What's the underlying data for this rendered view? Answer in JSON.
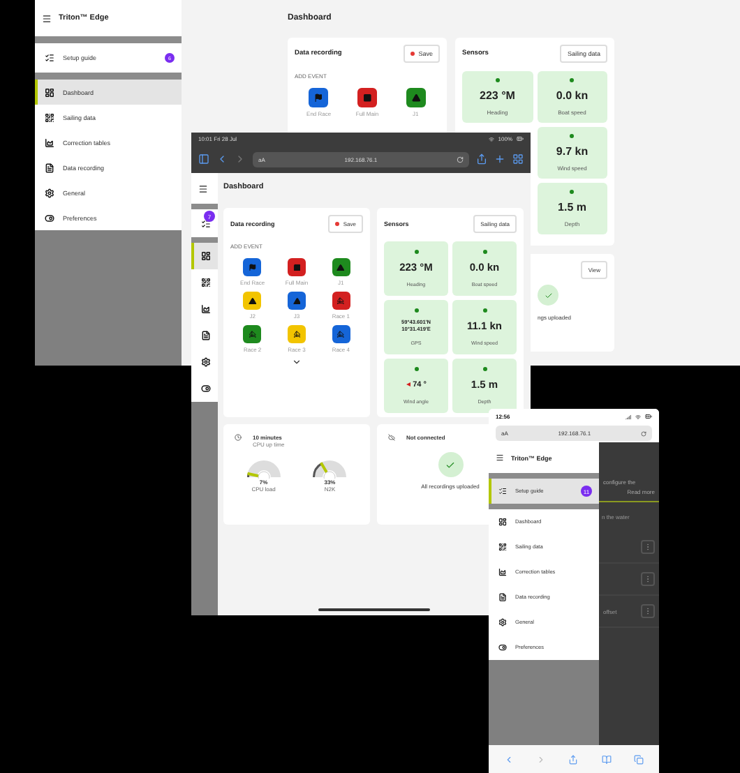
{
  "desktop": {
    "app_title": "Triton™ Edge",
    "setup": {
      "label": "Setup guide",
      "badge": "6",
      "selected": false
    },
    "nav": [
      {
        "kind": "dashboard",
        "label": "Dashboard",
        "selected": true
      },
      {
        "kind": "sailing",
        "label": "Sailing data",
        "selected": false
      },
      {
        "kind": "correction",
        "label": "Correction tables",
        "selected": false
      },
      {
        "kind": "recording",
        "label": "Data recording",
        "selected": false
      },
      {
        "kind": "general",
        "label": "General",
        "selected": false
      },
      {
        "kind": "preferences",
        "label": "Preferences",
        "selected": false
      }
    ],
    "page_title": "Dashboard",
    "recording": {
      "title": "Data recording",
      "save": "Save",
      "section": "ADD EVENT",
      "events": [
        {
          "kind": "flag",
          "label": "End Race",
          "color": "#1565d8"
        },
        {
          "kind": "main",
          "label": "Full Main",
          "color": "#d32020"
        },
        {
          "kind": "jib",
          "label": "J1",
          "color": "#1e8a1e"
        }
      ]
    },
    "sensors": {
      "title": "Sensors",
      "button": "Sailing data",
      "tiles": [
        {
          "value": "223 °M",
          "label": "Heading"
        },
        {
          "value": "0.0 kn",
          "label": "Boat speed"
        },
        {
          "value": "9.7 kn",
          "label": "Wind speed"
        },
        {
          "value": "1.5 m",
          "label": "Depth"
        }
      ]
    },
    "status_card": {
      "button": "View",
      "text": "ngs uploaded"
    }
  },
  "tablet": {
    "time": "10:01  Fri 28 Jul",
    "battery": "100%",
    "url_prefix": "aA",
    "url": "192.168.76.1",
    "setup_badge": "7",
    "nav": [
      {
        "kind": "dashboard",
        "selected": true
      },
      {
        "kind": "sailing",
        "selected": false
      },
      {
        "kind": "correction",
        "selected": false
      },
      {
        "kind": "recording",
        "selected": false
      },
      {
        "kind": "general",
        "selected": false
      },
      {
        "kind": "preferences",
        "selected": false
      }
    ],
    "page_title": "Dashboard",
    "recording": {
      "title": "Data recording",
      "save": "Save",
      "section": "ADD EVENT",
      "events": [
        {
          "kind": "flag",
          "label": "End Race",
          "color": "#1565d8"
        },
        {
          "kind": "main",
          "label": "Full Main",
          "color": "#d32020"
        },
        {
          "kind": "jib",
          "label": "J1",
          "color": "#1e8a1e"
        },
        {
          "kind": "jib",
          "label": "J2",
          "color": "#f2c400"
        },
        {
          "kind": "jib",
          "label": "J3",
          "color": "#1565d8"
        },
        {
          "kind": "race",
          "label": "Race 1",
          "color": "#d32020"
        },
        {
          "kind": "race",
          "label": "Race 2",
          "color": "#1e8a1e"
        },
        {
          "kind": "race",
          "label": "Race 3",
          "color": "#f2c400"
        },
        {
          "kind": "race",
          "label": "Race 4",
          "color": "#1565d8"
        }
      ]
    },
    "sensors": {
      "title": "Sensors",
      "button": "Sailing data",
      "tiles": [
        {
          "kind": "plain",
          "value": "223 °M",
          "label": "Heading"
        },
        {
          "kind": "plain",
          "value": "0.0 kn",
          "label": "Boat speed"
        },
        {
          "kind": "coords",
          "lines": [
            "59°43.601'N",
            "10°31.419'E"
          ],
          "label": "GPS"
        },
        {
          "kind": "plain",
          "value": "11.1 kn",
          "label": "Wind speed"
        },
        {
          "kind": "angle",
          "value": "74 °",
          "label": "Wind angle"
        },
        {
          "kind": "plain",
          "value": "1.5 m",
          "label": "Depth"
        }
      ]
    },
    "uptime": {
      "value": "10 minutes",
      "label": "CPU up time",
      "gauges": [
        {
          "reading": "7%",
          "label": "CPU load",
          "level": 0.07
        },
        {
          "reading": "33%",
          "label": "N2K",
          "level": 0.33
        }
      ]
    },
    "connection": {
      "title": "Not connected",
      "text": "All recordings uploaded"
    }
  },
  "phone": {
    "time": "12:56",
    "url_prefix": "aA",
    "url": "192.168.76.1",
    "app_title": "Triton™ Edge",
    "setup": {
      "label": "Setup guide",
      "badge": "11",
      "selected": true
    },
    "nav": [
      {
        "kind": "dashboard",
        "label": "Dashboard",
        "selected": false
      },
      {
        "kind": "sailing",
        "label": "Sailing data",
        "selected": false
      },
      {
        "kind": "correction",
        "label": "Correction tables",
        "selected": false
      },
      {
        "kind": "recording",
        "label": "Data recording",
        "selected": false
      },
      {
        "kind": "general",
        "label": "General",
        "selected": false
      },
      {
        "kind": "preferences",
        "label": "Preferences",
        "selected": false
      }
    ],
    "behind": {
      "notice": "configure the",
      "link": "Read more",
      "heading": "n the water",
      "row_label": "offset"
    }
  }
}
